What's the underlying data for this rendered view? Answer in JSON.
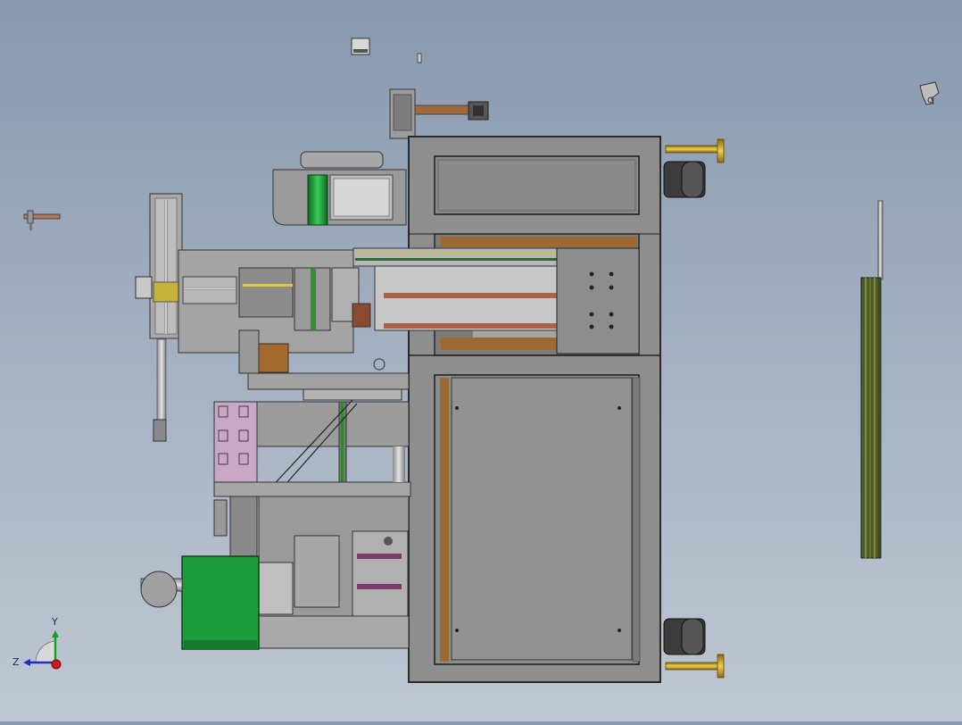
{
  "viewport": {
    "background_top": "#8898ae",
    "background_bottom": "#bfc7d2",
    "model_colors": {
      "frame": "#8a8a8a",
      "frame_dark": "#5e5e5e",
      "panel": "#9a9a9a",
      "green_motor": "#1c9a3c",
      "brass": "#c8a32a",
      "copper": "#b06a3a",
      "pink_plate": "#c9a7c6",
      "caster": "#3a3a3a"
    }
  },
  "triad": {
    "y_label": "Y",
    "z_label": "Z",
    "x_color": "#d01818",
    "y_color": "#12a022",
    "z_color": "#1830c8"
  }
}
